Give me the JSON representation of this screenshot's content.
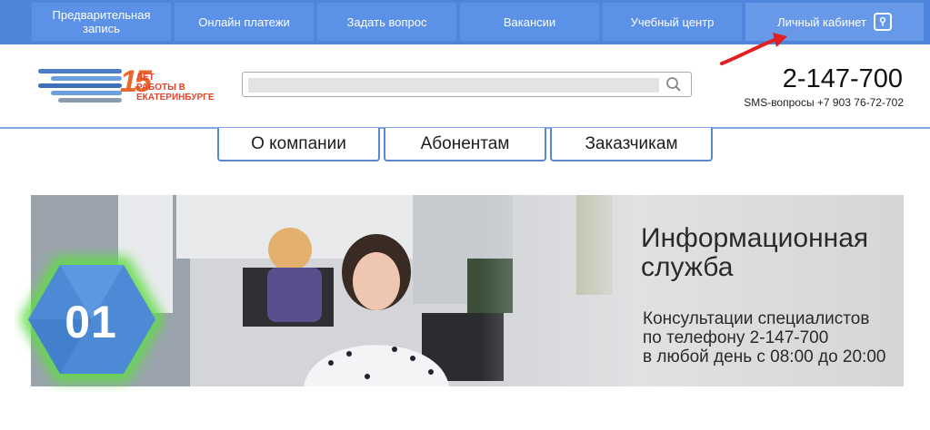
{
  "nav": {
    "items": [
      {
        "label": "Предварительная\nзапись"
      },
      {
        "label": "Онлайн платежи"
      },
      {
        "label": "Задать вопрос"
      },
      {
        "label": "Вакансии"
      },
      {
        "label": "Учебный центр"
      }
    ],
    "cabinet_label": "Личный кабинет"
  },
  "logo": {
    "number": "15",
    "text_line1": "ЛЕТ",
    "text_line2": "РАБОТЫ В",
    "text_line3": "ЕКАТЕРИНБУРГЕ"
  },
  "search": {
    "value": "",
    "placeholder": ""
  },
  "contacts": {
    "phone": "2-147-700",
    "sms": "SMS-вопросы +7 903 76-72-702"
  },
  "menu": {
    "items": [
      {
        "label": "О компании"
      },
      {
        "label": "Абонентам"
      },
      {
        "label": "Заказчикам"
      }
    ]
  },
  "banner": {
    "slide_number": "01",
    "title_line1": "Информационная",
    "title_line2": "служба",
    "text_line1": "Консультации специалистов",
    "text_line2": "по телефону 2-147-700",
    "text_line3": "в любой день с 08:00 до 20:00"
  },
  "colors": {
    "nav_bg": "#4f86dc",
    "nav_tab": "#5c91e8",
    "accent_red": "#e6442c",
    "menu_border": "#5b88d1",
    "hex_fill": "#4d8ad6",
    "hex_glow": "#5ed64a"
  }
}
